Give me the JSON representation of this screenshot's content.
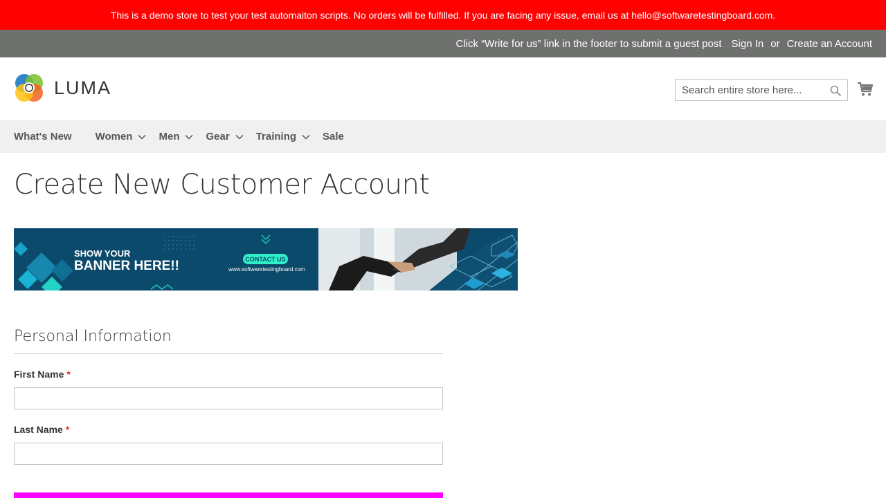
{
  "demo_notice": "This is a demo store to test your test automaiton scripts. No orders will be fulfilled. If you are facing any issue, email us at hello@softwaretestingboard.com.",
  "panel": {
    "promo": "Click “Write for us” link in the footer to submit a guest post",
    "sign_in": "Sign In",
    "or": "or",
    "create_account": "Create an Account"
  },
  "logo": {
    "text": "LUMA"
  },
  "search": {
    "placeholder": "Search entire store here..."
  },
  "nav": {
    "items": [
      {
        "label": "What's New"
      },
      {
        "label": "Women"
      },
      {
        "label": "Men"
      },
      {
        "label": "Gear"
      },
      {
        "label": "Training"
      },
      {
        "label": "Sale"
      }
    ]
  },
  "page_title": "Create New Customer Account",
  "banner": {
    "line1": "SHOW YOUR",
    "line2": "BANNER HERE!!",
    "cta": "CONTACT US",
    "url": "www.softwaretestingboard.com"
  },
  "form": {
    "legend": "Personal Information",
    "first_name_label": "First Name",
    "last_name_label": "Last Name",
    "required_mark": "*"
  },
  "colors": {
    "notice_bg": "#ff0101",
    "panel_bg": "#6e716e",
    "nav_bg": "#f0f0f0",
    "required": "#e02b27",
    "accent_bar": "#ff00ff"
  },
  "icons": [
    "search-icon",
    "cart-icon",
    "chevron-down-icon",
    "luma-logo-icon"
  ]
}
